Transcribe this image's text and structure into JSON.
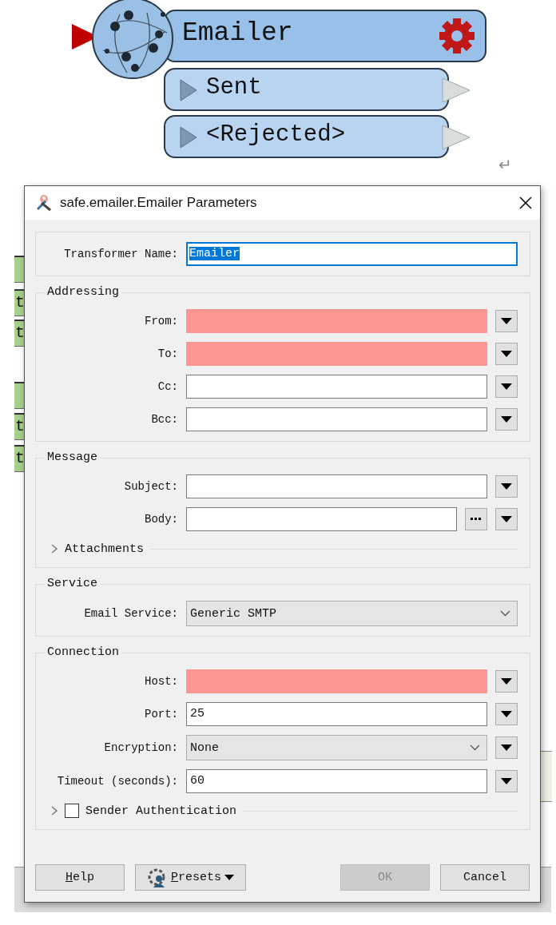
{
  "canvas": {
    "node": {
      "name": "Emailer",
      "ports": [
        {
          "label": "Sent"
        },
        {
          "label": "<Rejected>"
        }
      ]
    },
    "left_fragments": [
      {
        "kind": "cut"
      },
      {
        "kind": "label",
        "label": "t"
      },
      {
        "kind": "label",
        "label": "t"
      },
      {
        "kind": "cut"
      },
      {
        "kind": "label",
        "label": "t"
      },
      {
        "kind": "label",
        "label": "t"
      }
    ],
    "return_mark": "↵"
  },
  "dialog": {
    "title": "safe.emailer.Emailer Parameters",
    "sections": [
      {
        "rows": [
          {
            "kind": "text",
            "label": "Transformer Name:",
            "value": "Emailer",
            "value_selected": true,
            "required": false,
            "menu": false,
            "ellipsis": false
          }
        ]
      },
      {
        "title": "Addressing",
        "rows": [
          {
            "kind": "text",
            "label": "From:",
            "required": true,
            "menu": true,
            "ellipsis": false
          },
          {
            "kind": "text",
            "label": "To:",
            "required": true,
            "menu": true,
            "ellipsis": false
          },
          {
            "kind": "text",
            "label": "Cc:",
            "required": false,
            "menu": true,
            "ellipsis": false
          },
          {
            "kind": "text",
            "label": "Bcc:",
            "required": false,
            "menu": true,
            "ellipsis": false
          }
        ]
      },
      {
        "title": "Message",
        "rows": [
          {
            "kind": "text",
            "label": "Subject:",
            "required": false,
            "menu": true,
            "ellipsis": false
          },
          {
            "kind": "text",
            "label": "Body:",
            "required": false,
            "menu": true,
            "ellipsis": true
          },
          {
            "kind": "expander",
            "label": "Attachments",
            "expanded": false
          }
        ]
      },
      {
        "title": "Service",
        "rows": [
          {
            "kind": "combo",
            "label": "Email Service:",
            "value": "Generic SMTP",
            "menu": false
          }
        ]
      },
      {
        "title": "Connection",
        "rows": [
          {
            "kind": "text",
            "label": "Host:",
            "required": true,
            "menu": true,
            "ellipsis": false
          },
          {
            "kind": "text",
            "label": "Port:",
            "value": "25",
            "required": false,
            "menu": true,
            "ellipsis": false
          },
          {
            "kind": "combo",
            "label": "Encryption:",
            "value": "None",
            "menu": true
          },
          {
            "kind": "text",
            "label": "Timeout (seconds):",
            "value": "60",
            "required": false,
            "menu": true,
            "ellipsis": false
          },
          {
            "kind": "check_expander",
            "label": "Sender Authentication",
            "expanded": false,
            "checked": false
          }
        ]
      }
    ],
    "buttons": [
      {
        "label": "Help",
        "kind": "plain",
        "mnemonic": true,
        "disabled": false
      },
      {
        "label": "Presets",
        "kind": "menu",
        "mnemonic": true,
        "disabled": false
      },
      {
        "label": "OK",
        "kind": "plain",
        "mnemonic": false,
        "disabled": true
      },
      {
        "label": "Cancel",
        "kind": "plain",
        "mnemonic": false,
        "disabled": false
      }
    ]
  }
}
